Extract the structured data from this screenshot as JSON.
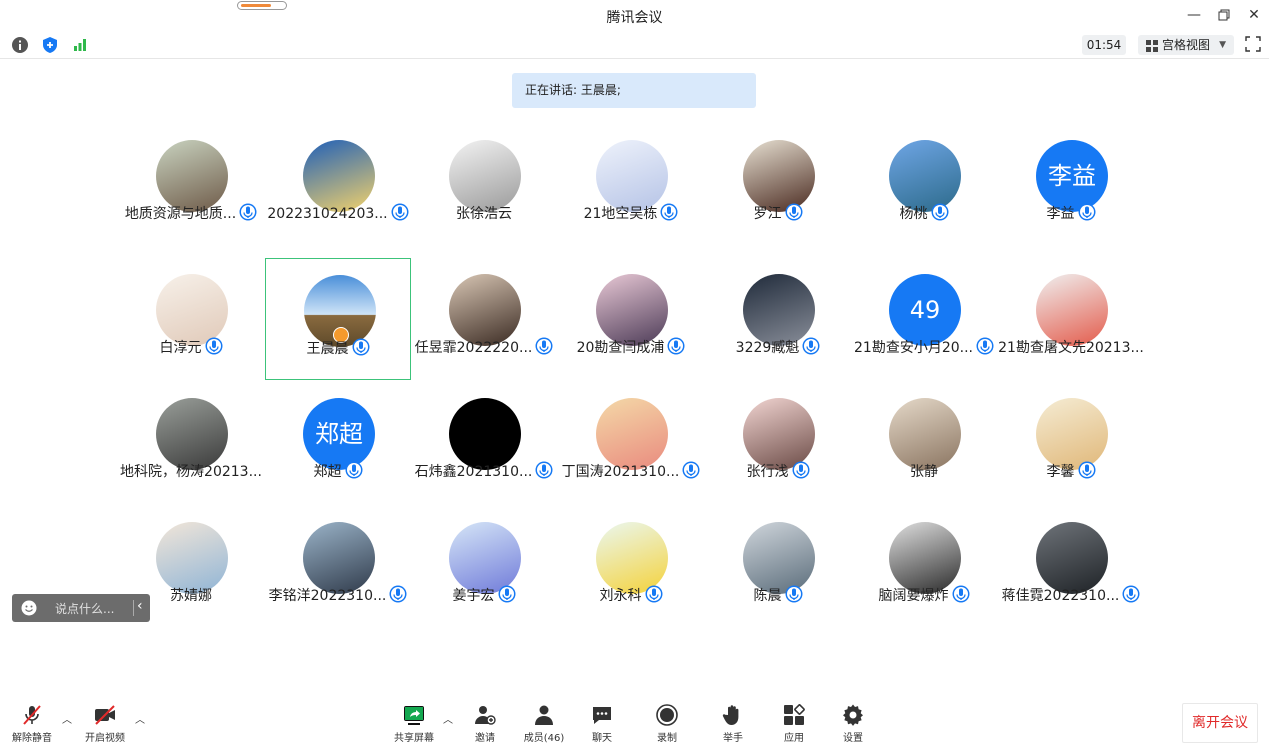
{
  "window": {
    "title": "腾讯会议"
  },
  "toolbar": {
    "timer": "01:54",
    "view_label": "宫格视图"
  },
  "speaker_banner": "正在讲话: 王晨晨;",
  "participants": [
    {
      "name": "地质资源与地质...",
      "avatar": "photo",
      "mic": true
    },
    {
      "name": "202231024203...",
      "avatar": "photo",
      "mic": true
    },
    {
      "name": "张徐浩云",
      "avatar": "photo",
      "mic": false
    },
    {
      "name": "21地空吴栋",
      "avatar": "photo",
      "mic": true
    },
    {
      "name": "罗江",
      "avatar": "photo",
      "mic": true
    },
    {
      "name": "杨桃",
      "avatar": "photo",
      "mic": true
    },
    {
      "name": "李益",
      "avatar": "text",
      "avatar_text": "李益",
      "mic": true
    },
    {
      "name": "白淳元",
      "avatar": "photo",
      "mic": true
    },
    {
      "name": "王晨晨",
      "avatar": "photo",
      "mic": true,
      "speaking": true,
      "host": true
    },
    {
      "name": "任昱霏2022220...",
      "avatar": "photo",
      "mic": true
    },
    {
      "name": "20勘查闫成浦",
      "avatar": "photo",
      "mic": true
    },
    {
      "name": "3229臧魁",
      "avatar": "photo",
      "mic": true
    },
    {
      "name": "21勘查安小月20...",
      "avatar": "text",
      "avatar_text": "49",
      "mic": true
    },
    {
      "name": "21勘查屠文先20213...",
      "avatar": "photo",
      "mic": false
    },
    {
      "name": "地科院，杨涛20213...",
      "avatar": "photo",
      "mic": false
    },
    {
      "name": "郑超",
      "avatar": "text",
      "avatar_text": "郑超",
      "mic": true
    },
    {
      "name": "石炜鑫2021310...",
      "avatar": "photo",
      "mic": true
    },
    {
      "name": "丁国涛2021310...",
      "avatar": "photo",
      "mic": true
    },
    {
      "name": "张行浅",
      "avatar": "photo",
      "mic": true
    },
    {
      "name": "张静",
      "avatar": "photo",
      "mic": false
    },
    {
      "name": "李馨",
      "avatar": "photo",
      "mic": true
    },
    {
      "name": "苏婧娜",
      "avatar": "photo",
      "mic": false
    },
    {
      "name": "李铭洋2022310...",
      "avatar": "photo",
      "mic": true
    },
    {
      "name": "姜宇宏",
      "avatar": "photo",
      "mic": true
    },
    {
      "name": "刘永科",
      "avatar": "photo",
      "mic": true
    },
    {
      "name": "陈晨",
      "avatar": "photo",
      "mic": true
    },
    {
      "name": "脑阔要爆炸",
      "avatar": "photo",
      "mic": true
    },
    {
      "name": "蒋佳霓2022310...",
      "avatar": "photo",
      "mic": true
    }
  ],
  "chat": {
    "placeholder": "说点什么..."
  },
  "bottom_bar": {
    "unmute": "解除静音",
    "start_video": "开启视频",
    "share_screen": "共享屏幕",
    "invite": "邀请",
    "members": "成员(46)",
    "chat": "聊天",
    "record": "录制",
    "raise_hand": "举手",
    "apps": "应用",
    "settings": "设置",
    "leave": "离开会议"
  },
  "colors": {
    "accent": "#1679f4",
    "leave": "#e02a2a",
    "active_border": "#3cc37a",
    "banner_bg": "#d9e9fb"
  }
}
